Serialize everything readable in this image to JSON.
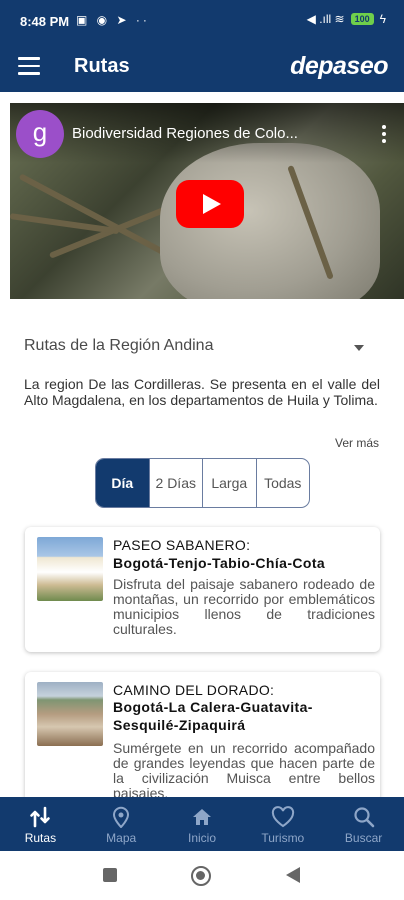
{
  "status_bar": {
    "time": "8:48 PM",
    "notification_icons": "▣ ◉ ➤ ··",
    "signal_icons": "◀ .ıll ≋",
    "battery": "100",
    "charging_icon": "ϟ"
  },
  "app_bar": {
    "title": "Rutas",
    "logo": "depaseo",
    "menu_icon": "hamburger-menu-icon"
  },
  "video": {
    "channel_initial": "g",
    "title": "Biodiversidad Regiones de Colo...",
    "play_icon": "play-icon"
  },
  "region_select": {
    "selected": "Rutas de la Región Andina"
  },
  "description": "La region De las Cordilleras. Se presenta en el valle del Alto Magdalena, en los departamentos de Huila y Tolima.",
  "see_more": "Ver más",
  "filters": [
    {
      "label": "Día",
      "active": true
    },
    {
      "label": "2 Días",
      "active": false
    },
    {
      "label": "Larga",
      "active": false
    },
    {
      "label": "Todas",
      "active": false
    }
  ],
  "routes": [
    {
      "title": "PASEO SABANERO:",
      "route": "Bogotá-Tenjo-Tabio-Chía-Cota",
      "description": "Disfruta del paisaje sabanero rodeado de montañas, un recorrido por emblemáticos municipios llenos de tradiciones culturales."
    },
    {
      "title": "CAMINO DEL DORADO:",
      "route": "Bogotá-La Calera-Guatavita-Sesquilé-Zipaquirá",
      "description": "Sumérgete en un recorrido acompañado de grandes leyendas que hacen parte de la civilización Muisca entre bellos paisajes."
    }
  ],
  "bottom_nav": [
    {
      "label": "Rutas",
      "icon": "routes-icon",
      "active": true
    },
    {
      "label": "Mapa",
      "icon": "map-pin-icon",
      "active": false
    },
    {
      "label": "Inicio",
      "icon": "home-icon",
      "active": false
    },
    {
      "label": "Turismo",
      "icon": "heart-icon",
      "active": false
    },
    {
      "label": "Buscar",
      "icon": "search-icon",
      "active": false
    }
  ],
  "colors": {
    "primary": "#123a6e",
    "play_button": "#ff0000",
    "channel_avatar": "#9b4fc9",
    "nav_inactive": "#8ea6c8"
  }
}
